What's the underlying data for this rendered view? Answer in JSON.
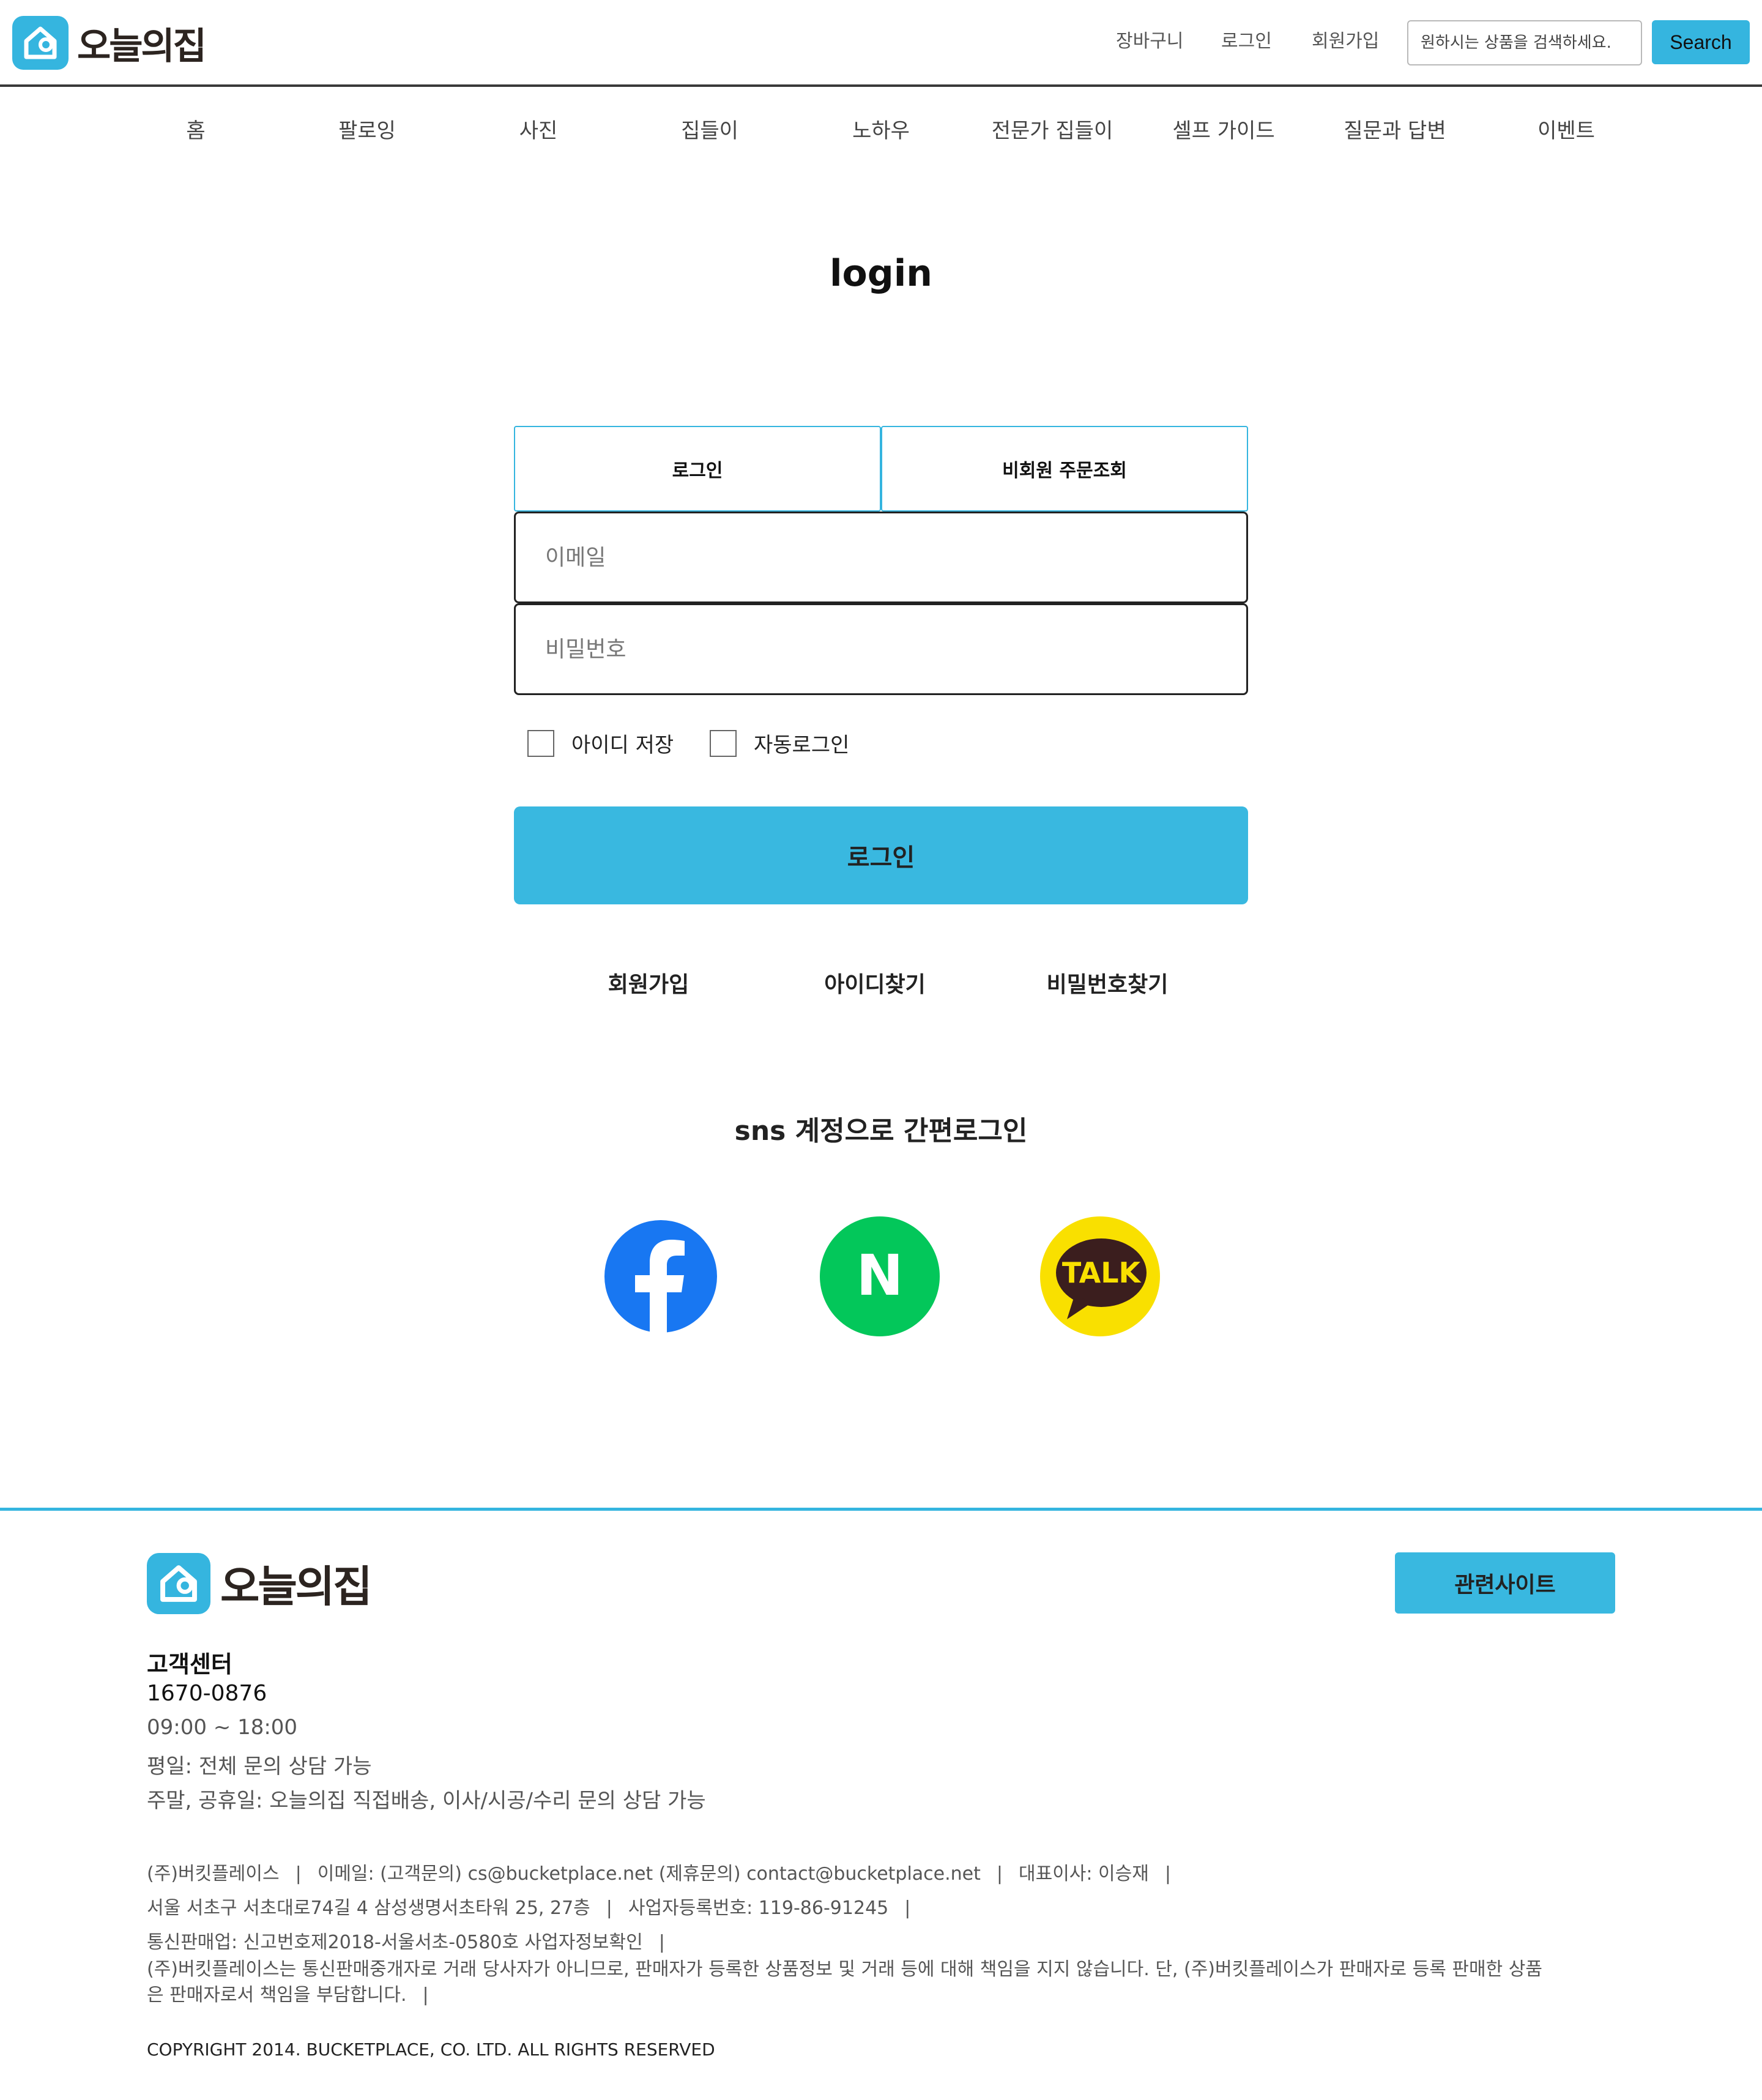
{
  "header": {
    "logo_text": "오늘의집",
    "links": [
      "장바구니",
      "로그인",
      "회원가입"
    ],
    "search_placeholder": "원하시는 상품을 검색하세요.",
    "search_label": "Search"
  },
  "nav": [
    "홈",
    "팔로잉",
    "사진",
    "집들이",
    "노하우",
    "전문가 집들이",
    "셀프 가이드",
    "질문과 답변",
    "이벤트"
  ],
  "login": {
    "title": "login",
    "tabs": [
      "로그인",
      "비회원 주문조회"
    ],
    "email_placeholder": "이메일",
    "password_placeholder": "비밀번호",
    "save_id_label": "아이디 저장",
    "auto_login_label": "자동로그인",
    "submit_label": "로그인",
    "links": [
      "회원가입",
      "아이디찾기",
      "비밀번호찾기"
    ],
    "sns_title": "sns 계정으로 간편로그인",
    "sns": [
      {
        "name": "facebook",
        "color": "#1877f2"
      },
      {
        "name": "naver",
        "color": "#03c75a",
        "glyph": "N"
      },
      {
        "name": "kakaotalk",
        "color": "#f9e000",
        "glyph": "TALK"
      }
    ]
  },
  "footer": {
    "logo_text": "오늘의집",
    "related_label": "관련사이트",
    "cs_title": "고객센터",
    "cs_phone": "1670-0876",
    "cs_lines": [
      "09:00 ~ 18:00",
      "평일: 전체 문의 상담 가능",
      "주말, 공휴일: 오늘의집 직접배송, 이사/시공/수리 문의 상담 가능"
    ],
    "info_line1": [
      "(주)버킷플레이스",
      "이메일: (고객문의) cs@bucketplace.net (제휴문의) contact@bucketplace.net",
      "대표이사: 이승재"
    ],
    "info_line2": [
      "서울 서초구 서초대로74길 4 삼성생명서초타워 25, 27층",
      "사업자등록번호: 119-86-91245"
    ],
    "info_line3": [
      "통신판매업: 신고번호제2018-서울서초-0580호 사업자정보확인"
    ],
    "disclaimer_line1": "(주)버킷플레이스는 통신판매중개자로 거래 당사자가 아니므로, 판매자가 등록한 상품정보 및 거래 등에 대해 책임을 지지 않습니다. 단, (주)버킷플레이스가 판매자로 등록 판매한 상품",
    "disclaimer_line2": "은 판매자로서 책임을 부담합니다.",
    "copyright": "COPYRIGHT 2014. BUCKETPLACE, CO. LTD. ALL RIGHTS RESERVED"
  },
  "colors": {
    "accent": "#35b5df",
    "facebook": "#1877f2",
    "naver": "#03c75a",
    "kakao": "#f9e000"
  }
}
